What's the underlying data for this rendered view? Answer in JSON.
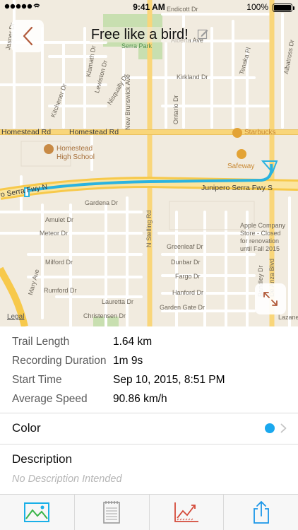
{
  "status_bar": {
    "time": "9:41 AM",
    "battery": "100%"
  },
  "header": {
    "title": "Free like a bird!"
  },
  "map": {
    "labels": {
      "serra_park": "Serra Park",
      "endicott_dr": "Endicott Dr",
      "alberta_ave": "Alberta Ave",
      "tenaka_pl": "Tenaka Pl",
      "albatross_dr": "Albatross Dr",
      "kirkland_dr": "Kirkland Dr",
      "ontario_dr": "Ontario Dr",
      "homestead_rd_left": "Homestead Rd",
      "homestead_rd_right": "Homestead Rd",
      "homestead_school": "Homestead\nHigh School",
      "starbucks": "Starbucks",
      "safeway": "Safeway",
      "junipero_left": "Junipero Serra Fwy N",
      "junipero_right": "Junipero Serra Fwy S",
      "gardena_dr": "Gardena Dr",
      "amulet_dr": "Amulet Dr",
      "meteor_dr": "Meteor Dr",
      "milford_dr": "Milford Dr",
      "rumford_dr": "Rumford Dr",
      "greenleaf_dr": "Greenleaf Dr",
      "dunbar_dr": "Dunbar Dr",
      "fargo_dr": "Fargo Dr",
      "hanford_dr": "Hanford Dr",
      "garden_gate_dr": "Garden Gate Dr",
      "lauretta_dr": "Lauretta Dr",
      "christensen_dr": "Christensen Dr",
      "apple_store": "Apple Company\nStore - Closed\nfor renovation\nuntil Fall 2015",
      "n_stelling_rd": "N Stelling Rd",
      "new_brunswick_ave": "New Brunswick Ave",
      "lazaneo": "Lazane",
      "kitchener_dr": "Kitchener Dr",
      "klamath_dr": "Klamath Dr",
      "lewiston_dr": "Lewiston Dr",
      "nisqually_dr": "Nisqually Dr",
      "mary_ave": "Mary Ave",
      "bandley_dr": "Bandley Dr",
      "de_anza_blvd": "De Anza Blvd",
      "jasper_dr": "Jasper Dr"
    },
    "legal": "Legal",
    "route_color": "#2ab3e0"
  },
  "stats": [
    {
      "label": "Trail Length",
      "value": "1.64 km"
    },
    {
      "label": "Recording Duration",
      "value": "1m 9s"
    },
    {
      "label": "Start Time",
      "value": "Sep 10, 2015, 8:51 PM"
    },
    {
      "label": "Average Speed",
      "value": "90.86 km/h"
    }
  ],
  "color_setting": {
    "label": "Color",
    "value_color": "#1aa8ee"
  },
  "description": {
    "heading": "Description",
    "text": "No Description Intended"
  },
  "tabs": [
    {
      "icon": "landscape-map-icon",
      "color": "#1ab0e8"
    },
    {
      "icon": "notepad-icon",
      "color": "#9a9a9a"
    },
    {
      "icon": "line-chart-icon",
      "color": "#d44a3a"
    },
    {
      "icon": "share-icon",
      "color": "#1a96e8"
    }
  ],
  "colors": {
    "accent": "#1a96e8",
    "route": "#2ab3e0"
  }
}
